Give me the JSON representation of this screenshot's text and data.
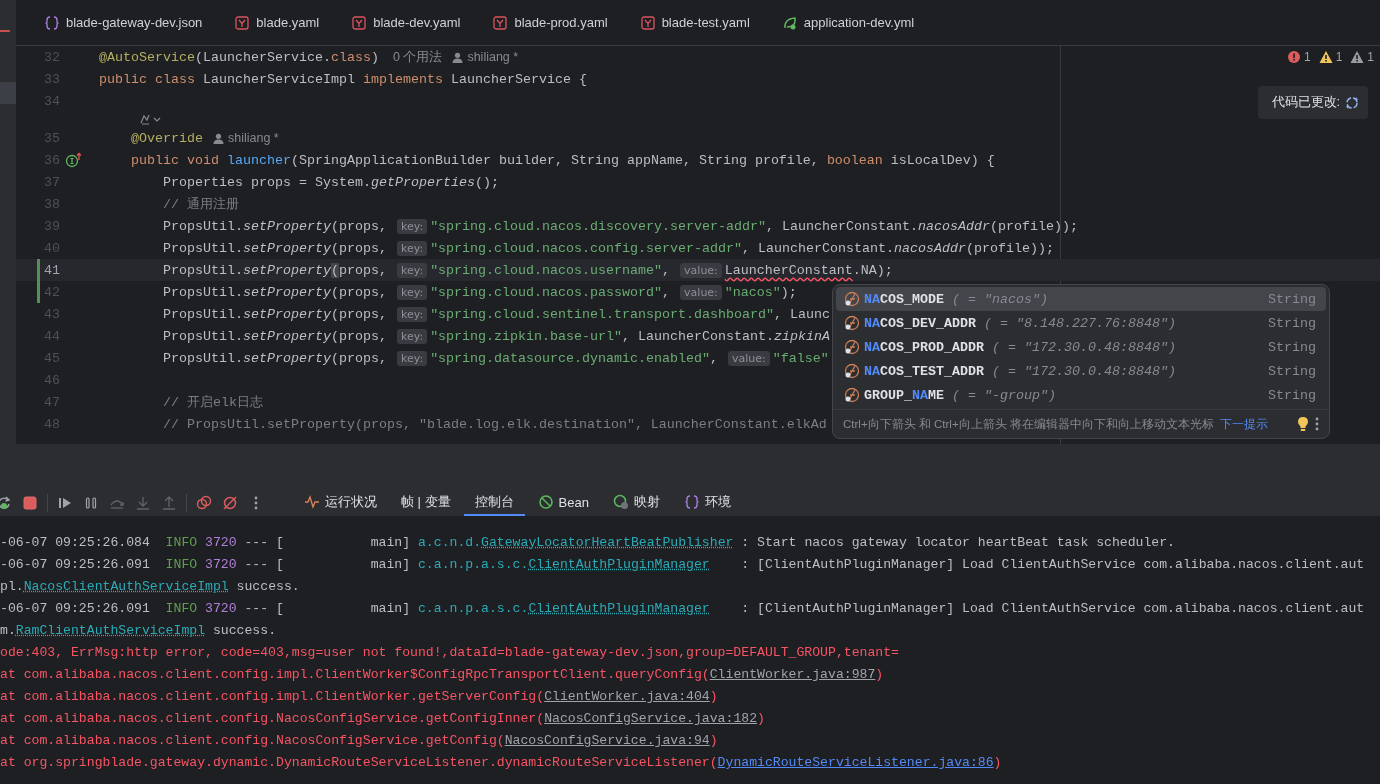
{
  "editor_tabs": [
    {
      "label": "blade-gateway-dev.json",
      "kind": "json"
    },
    {
      "label": "blade.yaml",
      "kind": "yaml"
    },
    {
      "label": "blade-dev.yaml",
      "kind": "yaml"
    },
    {
      "label": "blade-prod.yaml",
      "kind": "yaml"
    },
    {
      "label": "blade-test.yaml",
      "kind": "yaml"
    },
    {
      "label": "application-dev.yml",
      "kind": "spring"
    }
  ],
  "inspections": [
    {
      "kind": "error",
      "count": "1"
    },
    {
      "kind": "warning",
      "count": "1"
    },
    {
      "kind": "weak_warning",
      "count": "1"
    }
  ],
  "notice": {
    "text": "代码已更改:"
  },
  "code_lines": [
    {
      "number": "32",
      "current": false,
      "changed": false,
      "tokens": [
        {
          "kind": "annotation",
          "text": "@AutoService"
        },
        {
          "kind": "plain",
          "text": "(LauncherService."
        },
        {
          "kind": "keyword",
          "text": "class"
        },
        {
          "kind": "plain",
          "text": ")"
        }
      ],
      "usages": "0 个用法",
      "author": "shiliang *"
    },
    {
      "number": "33",
      "current": false,
      "changed": false,
      "tokens": [
        {
          "kind": "keyword",
          "text": "public class "
        },
        {
          "kind": "plain",
          "text": "LauncherServiceImpl"
        },
        {
          "kind": "keyword",
          "text": " implements "
        },
        {
          "kind": "plain",
          "text": "LauncherService {"
        }
      ]
    },
    {
      "number": "34",
      "current": false,
      "changed": false
    },
    {
      "number": "35",
      "current": false,
      "changed": false,
      "inlay_above": true,
      "tokens": [
        {
          "kind": "annotation",
          "text": "    @Override"
        }
      ],
      "author": "shiliang *"
    },
    {
      "number": "36",
      "current": false,
      "changed": false,
      "implements": true,
      "tokens": [
        {
          "kind": "keyword",
          "text": "    public void "
        },
        {
          "kind": "function",
          "text": "launcher"
        },
        {
          "kind": "plain",
          "text": "(SpringApplicationBuilder builder, String appName, String profile, "
        },
        {
          "kind": "keyword",
          "text": "boolean"
        },
        {
          "kind": "plain",
          "text": " isLocalDev) {"
        }
      ]
    },
    {
      "number": "37",
      "current": false,
      "changed": false,
      "tokens": [
        {
          "kind": "plain",
          "text": "        Properties props = System."
        },
        {
          "kind": "static",
          "text": "getProperties"
        },
        {
          "kind": "plain",
          "text": "();"
        }
      ]
    },
    {
      "number": "38",
      "current": false,
      "changed": false,
      "tokens": [
        {
          "kind": "comment",
          "text": "        // 通用注册"
        }
      ]
    },
    {
      "number": "39",
      "current": false,
      "changed": false,
      "tokens": [
        {
          "kind": "plain",
          "text": "        PropsUtil."
        },
        {
          "kind": "static",
          "text": "setProperty"
        },
        {
          "kind": "plain",
          "text": "(props, "
        },
        {
          "kind": "hint",
          "text": "key:"
        },
        {
          "kind": "string",
          "text": "\"spring.cloud.nacos.discovery.server-addr\""
        },
        {
          "kind": "plain",
          "text": ", LauncherConstant."
        },
        {
          "kind": "static",
          "text": "nacosAddr"
        },
        {
          "kind": "plain",
          "text": "(profile));"
        }
      ]
    },
    {
      "number": "40",
      "current": false,
      "changed": false,
      "tokens": [
        {
          "kind": "plain",
          "text": "        PropsUtil."
        },
        {
          "kind": "static",
          "text": "setProperty"
        },
        {
          "kind": "plain",
          "text": "(props, "
        },
        {
          "kind": "hint",
          "text": "key:"
        },
        {
          "kind": "string",
          "text": "\"spring.cloud.nacos.config.server-addr\""
        },
        {
          "kind": "plain",
          "text": ", LauncherConstant."
        },
        {
          "kind": "static",
          "text": "nacosAddr"
        },
        {
          "kind": "plain",
          "text": "(profile));"
        }
      ]
    },
    {
      "number": "41",
      "current": true,
      "changed": true,
      "tokens": [
        {
          "kind": "plain",
          "text": "        PropsUtil."
        },
        {
          "kind": "static",
          "text": "setProperty"
        },
        {
          "kind": "brace",
          "text": "("
        },
        {
          "kind": "plain",
          "text": "props, "
        },
        {
          "kind": "hint",
          "text": "key:"
        },
        {
          "kind": "string",
          "text": "\"spring.cloud.nacos.username\""
        },
        {
          "kind": "plain",
          "text": ", "
        },
        {
          "kind": "hint",
          "text": "value:"
        },
        {
          "kind": "error",
          "text": "LauncherConstant"
        },
        {
          "kind": "plain",
          "text": ".NA);"
        }
      ]
    },
    {
      "number": "42",
      "current": false,
      "changed": true,
      "tokens": [
        {
          "kind": "plain",
          "text": "        PropsUtil."
        },
        {
          "kind": "static",
          "text": "setProperty"
        },
        {
          "kind": "plain",
          "text": "(props, "
        },
        {
          "kind": "hint",
          "text": "key:"
        },
        {
          "kind": "string",
          "text": "\"spring.cloud.nacos.password\""
        },
        {
          "kind": "plain",
          "text": ", "
        },
        {
          "kind": "hint",
          "text": "value:"
        },
        {
          "kind": "string",
          "text": "\"nacos\""
        },
        {
          "kind": "plain",
          "text": ");"
        }
      ]
    },
    {
      "number": "43",
      "current": false,
      "changed": false,
      "tokens": [
        {
          "kind": "plain",
          "text": "        PropsUtil."
        },
        {
          "kind": "static",
          "text": "setProperty"
        },
        {
          "kind": "plain",
          "text": "(props, "
        },
        {
          "kind": "hint",
          "text": "key:"
        },
        {
          "kind": "string",
          "text": "\"spring.cloud.sentinel.transport.dashboard\""
        },
        {
          "kind": "plain",
          "text": ", Launc"
        }
      ]
    },
    {
      "number": "44",
      "current": false,
      "changed": false,
      "tokens": [
        {
          "kind": "plain",
          "text": "        PropsUtil."
        },
        {
          "kind": "static",
          "text": "setProperty"
        },
        {
          "kind": "plain",
          "text": "(props, "
        },
        {
          "kind": "hint",
          "text": "key:"
        },
        {
          "kind": "string",
          "text": "\"spring.zipkin.base-url\""
        },
        {
          "kind": "plain",
          "text": ", LauncherConstant."
        },
        {
          "kind": "static",
          "text": "zipkinA"
        }
      ]
    },
    {
      "number": "45",
      "current": false,
      "changed": false,
      "tokens": [
        {
          "kind": "plain",
          "text": "        PropsUtil."
        },
        {
          "kind": "static",
          "text": "setProperty"
        },
        {
          "kind": "plain",
          "text": "(props, "
        },
        {
          "kind": "hint",
          "text": "key:"
        },
        {
          "kind": "string",
          "text": "\"spring.datasource.dynamic.enabled\""
        },
        {
          "kind": "plain",
          "text": ", "
        },
        {
          "kind": "hint",
          "text": "value:"
        },
        {
          "kind": "string",
          "text": "\"false\""
        }
      ]
    },
    {
      "number": "46",
      "current": false,
      "changed": false
    },
    {
      "number": "47",
      "current": false,
      "changed": false,
      "tokens": [
        {
          "kind": "comment",
          "text": "        // 开启elk日志"
        }
      ]
    },
    {
      "number": "48",
      "current": false,
      "changed": false,
      "tokens": [
        {
          "kind": "comment",
          "text": "        // PropsUtil.setProperty(props, \"blade.log.elk.destination\", LauncherConstant.elkAd"
        }
      ]
    }
  ],
  "completion": {
    "items": [
      {
        "name": [
          {
            "text": "NA",
            "matched": true
          },
          {
            "text": "COS_MODE",
            "matched": false
          }
        ],
        "detail": "( = \"nacos\")",
        "type": "String",
        "selected": true
      },
      {
        "name": [
          {
            "text": "NA",
            "matched": true
          },
          {
            "text": "COS_DEV_ADDR",
            "matched": false
          }
        ],
        "detail": "( = \"8.148.227.76:8848\")",
        "type": "String",
        "selected": false
      },
      {
        "name": [
          {
            "text": "NA",
            "matched": true
          },
          {
            "text": "COS_PROD_ADDR",
            "matched": false
          }
        ],
        "detail": "( = \"172.30.0.48:8848\")",
        "type": "String",
        "selected": false
      },
      {
        "name": [
          {
            "text": "NA",
            "matched": true
          },
          {
            "text": "COS_TEST_ADDR",
            "matched": false
          }
        ],
        "detail": "( = \"172.30.0.48:8848\")",
        "type": "String",
        "selected": false
      },
      {
        "name": [
          {
            "text": "GROUP_",
            "matched": false
          },
          {
            "text": "NA",
            "matched": true
          },
          {
            "text": "ME",
            "matched": false
          }
        ],
        "detail": "( = \"-group\")",
        "type": "String",
        "selected": false
      }
    ],
    "hint": "Ctrl+向下箭头 和 Ctrl+向上箭头 将在编辑器中向下和向上移动文本光标",
    "next_tip": "下一提示"
  },
  "debug_toolbar": {
    "buttons": [
      {
        "kind": "rerun",
        "disabled": false
      },
      {
        "kind": "stop",
        "disabled": false
      },
      {
        "kind": "separator"
      },
      {
        "kind": "resume",
        "disabled": false
      },
      {
        "kind": "pause",
        "disabled": false
      },
      {
        "kind": "step_over",
        "disabled": true
      },
      {
        "kind": "step_into",
        "disabled": true
      },
      {
        "kind": "step_out",
        "disabled": true
      },
      {
        "kind": "separator"
      },
      {
        "kind": "breakpoints",
        "disabled": false
      },
      {
        "kind": "mute",
        "disabled": false
      },
      {
        "kind": "more",
        "disabled": false
      }
    ],
    "tabs": [
      {
        "label": "运行状况",
        "kind": "pulse",
        "selected": false
      },
      {
        "label": "帧 | 变量",
        "kind": "text",
        "selected": false
      },
      {
        "label": "控制台",
        "kind": "text",
        "selected": true
      },
      {
        "label": "Bean",
        "kind": "bean",
        "selected": false
      },
      {
        "label": "映射",
        "kind": "mapping",
        "selected": false
      },
      {
        "label": "环境",
        "kind": "env",
        "selected": false
      }
    ]
  },
  "console_lines": [
    {
      "tokens": [
        {
          "kind": "plain",
          "text": "-06-07 09:25:26.084  "
        },
        {
          "kind": "info",
          "text": "INFO"
        },
        {
          "kind": "pid",
          "text": " 3720"
        },
        {
          "kind": "plain",
          "text": " --- [           main] "
        },
        {
          "kind": "logger",
          "text": "a.c.n.d."
        },
        {
          "kind": "logger_link",
          "text": "GatewayLocatorHeartBeatPublisher"
        },
        {
          "kind": "plain",
          "text": " : Start nacos gateway locator heartBeat task scheduler."
        }
      ]
    },
    {
      "tokens": [
        {
          "kind": "plain",
          "text": "-06-07 09:25:26.091  "
        },
        {
          "kind": "info",
          "text": "INFO"
        },
        {
          "kind": "pid",
          "text": " 3720"
        },
        {
          "kind": "plain",
          "text": " --- [           main] "
        },
        {
          "kind": "logger",
          "text": "c.a.n.p.a.s.c."
        },
        {
          "kind": "logger_link",
          "text": "ClientAuthPluginManager"
        },
        {
          "kind": "plain",
          "text": "    : [ClientAuthPluginManager] Load ClientAuthService com.alibaba.nacos.client.aut"
        }
      ]
    },
    {
      "tokens": [
        {
          "kind": "plain",
          "text": "pl."
        },
        {
          "kind": "logger_link",
          "text": "NacosClientAuthServiceImpl"
        },
        {
          "kind": "plain",
          "text": " success."
        }
      ]
    },
    {
      "tokens": [
        {
          "kind": "plain",
          "text": "-06-07 09:25:26.091  "
        },
        {
          "kind": "info",
          "text": "INFO"
        },
        {
          "kind": "pid",
          "text": " 3720"
        },
        {
          "kind": "plain",
          "text": " --- [           main] "
        },
        {
          "kind": "logger",
          "text": "c.a.n.p.a.s.c."
        },
        {
          "kind": "logger_link",
          "text": "ClientAuthPluginManager"
        },
        {
          "kind": "plain",
          "text": "    : [ClientAuthPluginManager] Load ClientAuthService com.alibaba.nacos.client.aut"
        }
      ]
    },
    {
      "tokens": [
        {
          "kind": "plain",
          "text": "m."
        },
        {
          "kind": "logger_link",
          "text": "RamClientAuthServiceImpl"
        },
        {
          "kind": "plain",
          "text": " success."
        }
      ]
    },
    {
      "tokens": [
        {
          "kind": "error",
          "text": "ode:403, ErrMsg:http error, code=403,msg=user not found!,dataId=blade-gateway-dev.json,group=DEFAULT_GROUP,tenant="
        }
      ]
    },
    {
      "tokens": [
        {
          "kind": "error",
          "text": "at com.alibaba.nacos.client.config.impl.ClientWorker$ConfigRpcTransportClient.queryConfig("
        },
        {
          "kind": "library_link",
          "text": "ClientWorker.java:987"
        },
        {
          "kind": "error",
          "text": ")"
        }
      ]
    },
    {
      "tokens": [
        {
          "kind": "error",
          "text": "at com.alibaba.nacos.client.config.impl.ClientWorker.getServerConfig("
        },
        {
          "kind": "library_link",
          "text": "ClientWorker.java:404"
        },
        {
          "kind": "error",
          "text": ")"
        }
      ]
    },
    {
      "tokens": [
        {
          "kind": "error",
          "text": "at com.alibaba.nacos.client.config.NacosConfigService.getConfigInner("
        },
        {
          "kind": "library_link",
          "text": "NacosConfigService.java:182"
        },
        {
          "kind": "error",
          "text": ")"
        }
      ]
    },
    {
      "tokens": [
        {
          "kind": "error",
          "text": "at com.alibaba.nacos.client.config.NacosConfigService.getConfig("
        },
        {
          "kind": "library_link",
          "text": "NacosConfigService.java:94"
        },
        {
          "kind": "error",
          "text": ")"
        }
      ]
    },
    {
      "tokens": [
        {
          "kind": "error",
          "text": "at org.springblade.gateway.dynamic.DynamicRouteServiceListener.dynamicRouteServiceListener("
        },
        {
          "kind": "project_link",
          "text": "DynamicRouteServiceListener.java:86"
        },
        {
          "kind": "error",
          "text": ")"
        }
      ]
    }
  ]
}
